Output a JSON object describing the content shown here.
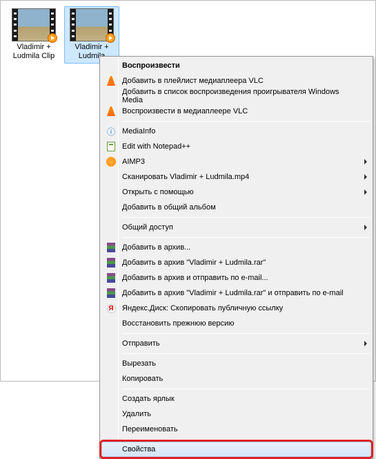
{
  "files": [
    {
      "label": "Vladimir + Ludmila Clip"
    },
    {
      "label": "Vladimir + Ludmila"
    }
  ],
  "menu": {
    "groups": [
      [
        {
          "label": "Воспроизвести",
          "bold": true
        },
        {
          "label": "Добавить в плейлист медиаплеера VLC",
          "icon": "vlc"
        },
        {
          "label": "Добавить в список воспроизведения проигрывателя Windows Media"
        },
        {
          "label": "Воспроизвести в медиаплеере VLC",
          "icon": "vlc"
        }
      ],
      [
        {
          "label": "MediaInfo",
          "icon": "mediainfo"
        },
        {
          "label": "Edit with Notepad++",
          "icon": "notepad"
        },
        {
          "label": "AIMP3",
          "icon": "aimp",
          "submenu": true
        },
        {
          "label": "Сканировать Vladimir + Ludmila.mp4",
          "submenu": true
        },
        {
          "label": "Открыть с помощью",
          "submenu": true
        },
        {
          "label": "Добавить в общий альбом"
        }
      ],
      [
        {
          "label": "Общий доступ",
          "submenu": true
        }
      ],
      [
        {
          "label": "Добавить в архив...",
          "icon": "rar"
        },
        {
          "label": "Добавить в архив \"Vladimir + Ludmila.rar\"",
          "icon": "rar"
        },
        {
          "label": "Добавить в архив и отправить по e-mail...",
          "icon": "rar"
        },
        {
          "label": "Добавить в архив \"Vladimir + Ludmila.rar\" и отправить по e-mail",
          "icon": "rar"
        },
        {
          "label": "Яндекс.Диск: Скопировать публичную ссылку",
          "icon": "yandex"
        },
        {
          "label": "Восстановить прежнюю версию"
        }
      ],
      [
        {
          "label": "Отправить",
          "submenu": true
        }
      ],
      [
        {
          "label": "Вырезать"
        },
        {
          "label": "Копировать"
        }
      ],
      [
        {
          "label": "Создать ярлык"
        },
        {
          "label": "Удалить"
        },
        {
          "label": "Переименовать"
        }
      ],
      [
        {
          "label": "Свойства",
          "highlight": true
        }
      ]
    ]
  }
}
